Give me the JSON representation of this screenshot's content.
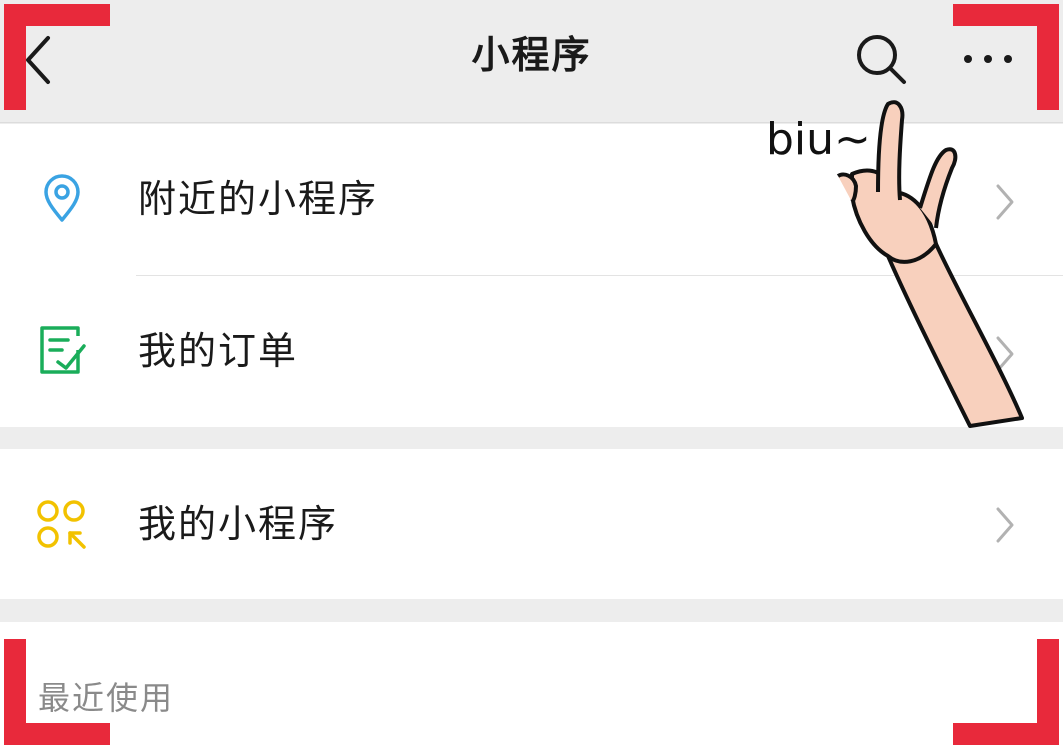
{
  "header": {
    "title": "小程序",
    "back_icon": "chevron-left-icon",
    "search_icon": "search-icon",
    "more_icon": "more-dots-icon"
  },
  "menu": {
    "items": [
      {
        "label": "附近的小程序",
        "icon": "location-pin-icon",
        "icon_color": "#3aa3e3"
      },
      {
        "label": "我的订单",
        "icon": "order-checklist-icon",
        "icon_color": "#1aad5a"
      },
      {
        "label": "我的小程序",
        "icon": "mini-program-grid-icon",
        "icon_color": "#f2c200"
      }
    ]
  },
  "recent": {
    "label": "最近使用"
  },
  "annotation": {
    "text": "biu~"
  },
  "colors": {
    "frame_corner": "#e8293b",
    "background": "#ededed",
    "row": "#ffffff"
  }
}
